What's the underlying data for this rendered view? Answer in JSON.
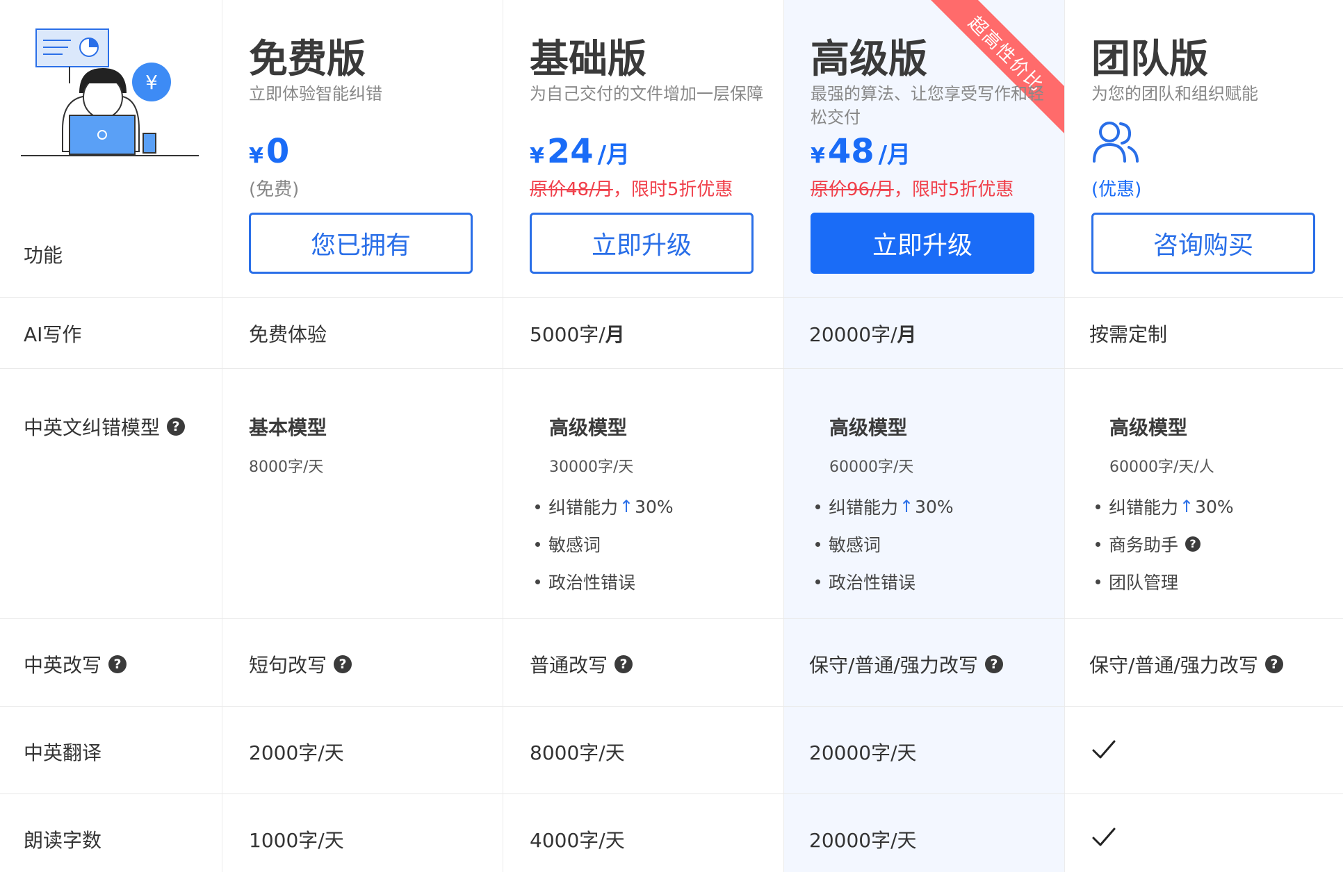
{
  "feature_column": {
    "header": "功能"
  },
  "plans": [
    {
      "name": "免费版",
      "desc": "立即体验智能纠错",
      "currency": "¥",
      "price": "0",
      "price_note": "(免费)",
      "button": "您已拥有"
    },
    {
      "name": "基础版",
      "desc": "为自己交付的文件增加一层保障",
      "currency": "¥",
      "price": "24",
      "unit": "/月",
      "promo_original": "原价48/月",
      "promo_text": "，限时5折优惠",
      "button": "立即升级"
    },
    {
      "name": "高级版",
      "desc": "最强的算法、让您享受写作和轻松交付",
      "currency": "¥",
      "price": "48",
      "unit": "/月",
      "promo_original": "原价96/月",
      "promo_text": "，限时5折优惠",
      "button": "立即升级",
      "ribbon": "超高性价比"
    },
    {
      "name": "团队版",
      "desc": "为您的团队和组织赋能",
      "price_note": "(优惠)",
      "button": "咨询购买"
    }
  ],
  "rows": {
    "ai_writing": {
      "label": "AI写作",
      "free": "免费体验",
      "basic": "5000字/",
      "basic_unit": "月",
      "pro": "20000字/",
      "pro_unit": "月",
      "team": "按需定制"
    },
    "model": {
      "label": "中英文纠错模型",
      "free": {
        "title": "基本模型",
        "quota": "8000字/天"
      },
      "basic": {
        "title": "高级模型",
        "quota": "30000字/天",
        "items": [
          "纠错能力",
          "敏感词",
          "政治性错误"
        ],
        "boost": "30%"
      },
      "pro": {
        "title": "高级模型",
        "quota": "60000字/天",
        "items": [
          "纠错能力",
          "敏感词",
          "政治性错误"
        ],
        "boost": "30%"
      },
      "team": {
        "title": "高级模型",
        "quota": "60000字/天/人",
        "items": [
          "纠错能力",
          "商务助手",
          "团队管理"
        ],
        "boost": "30%"
      }
    },
    "rewrite": {
      "label": "中英改写",
      "free": "短句改写",
      "basic": "普通改写",
      "pro": "保守/普通/强力改写",
      "team": "保守/普通/强力改写"
    },
    "translate": {
      "label": "中英翻译",
      "free": "2000字/天",
      "basic": "8000字/天",
      "pro": "20000字/天",
      "team": "✓"
    },
    "read_aloud": {
      "label": "朗读字数",
      "free": "1000字/天",
      "basic": "4000字/天",
      "pro": "20000字/天",
      "team": "✓"
    }
  },
  "colors": {
    "accent": "#1a6cf7",
    "promo": "#f0404b",
    "ribbon": "#ff6b6b",
    "highlight_bg": "#f3f7ff"
  },
  "icons": [
    "illustration-person-laptop",
    "help-icon",
    "team-users-icon",
    "check-icon",
    "up-arrow-icon"
  ]
}
